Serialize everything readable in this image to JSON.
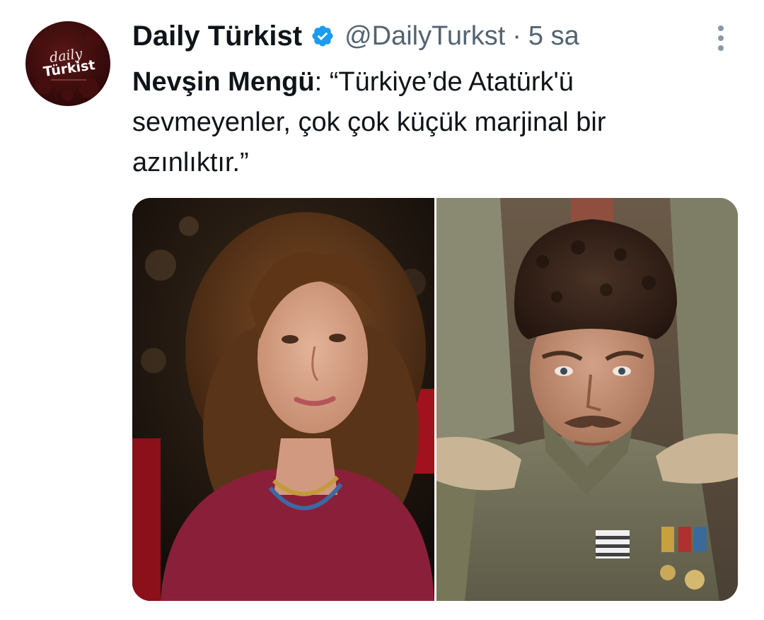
{
  "account": {
    "display_name": "Daily Türkist",
    "handle": "@DailyTurkst",
    "separator": "·",
    "time": "5 sa",
    "verified_icon": "verified-badge-icon",
    "verified_color": "#1d9bf0",
    "avatar": {
      "logo_line1": "daily",
      "logo_line2": "Türkist",
      "background_color": "#3a0c0c"
    }
  },
  "tweet": {
    "speaker": "Nevşin Mengü",
    "speaker_suffix": ":",
    "quote": " “Türkiye’de Atatürk'ü sevmeyenler, çok çok küçük marjinal bir azınlıktır.”"
  },
  "media": {
    "images": [
      {
        "icon": "woman-portrait-photo"
      },
      {
        "icon": "man-uniform-portrait-photo"
      }
    ]
  },
  "menu": {
    "icon": "more-options-icon"
  },
  "colors": {
    "text_primary": "#0f1419",
    "text_secondary": "#536471",
    "background": "#ffffff"
  }
}
